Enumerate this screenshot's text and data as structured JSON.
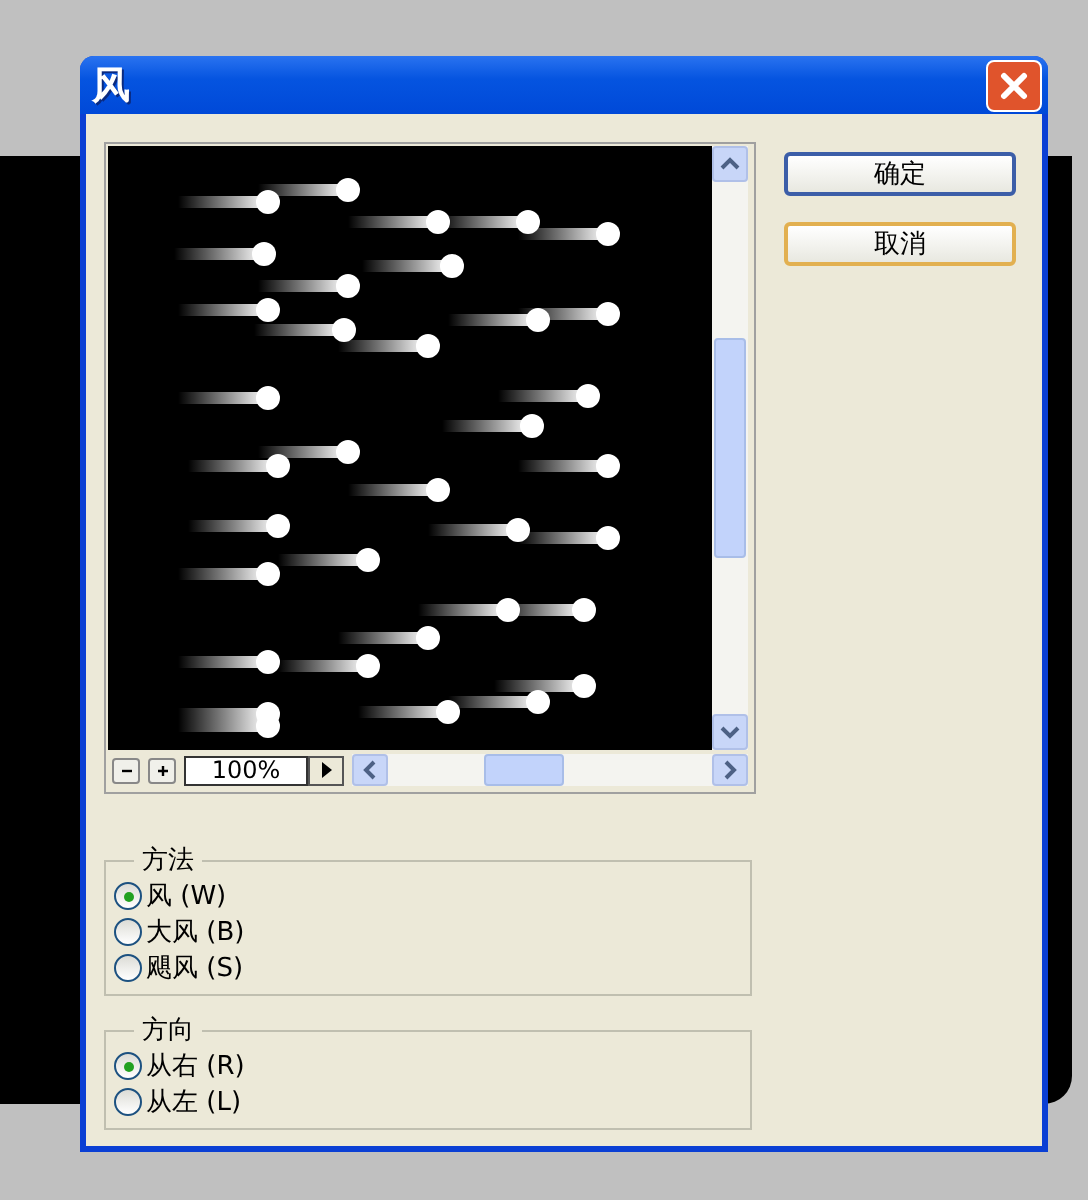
{
  "window": {
    "title": "风"
  },
  "preview": {
    "kind": "picture",
    "zoom": "100%"
  },
  "buttons": [
    {
      "label": "确定",
      "kind": "default"
    },
    {
      "label": "取消",
      "kind": "normal"
    }
  ],
  "groups": [
    {
      "title": "方法",
      "options": [
        {
          "label": "风 (W)",
          "selected": true
        },
        {
          "label": "大风 (B)",
          "selected": false
        },
        {
          "label": "飓风 (S)",
          "selected": false
        }
      ]
    },
    {
      "title": "方向",
      "options": [
        {
          "label": "从右 (R)",
          "selected": true
        },
        {
          "label": "从左 (L)",
          "selected": false
        }
      ]
    }
  ]
}
